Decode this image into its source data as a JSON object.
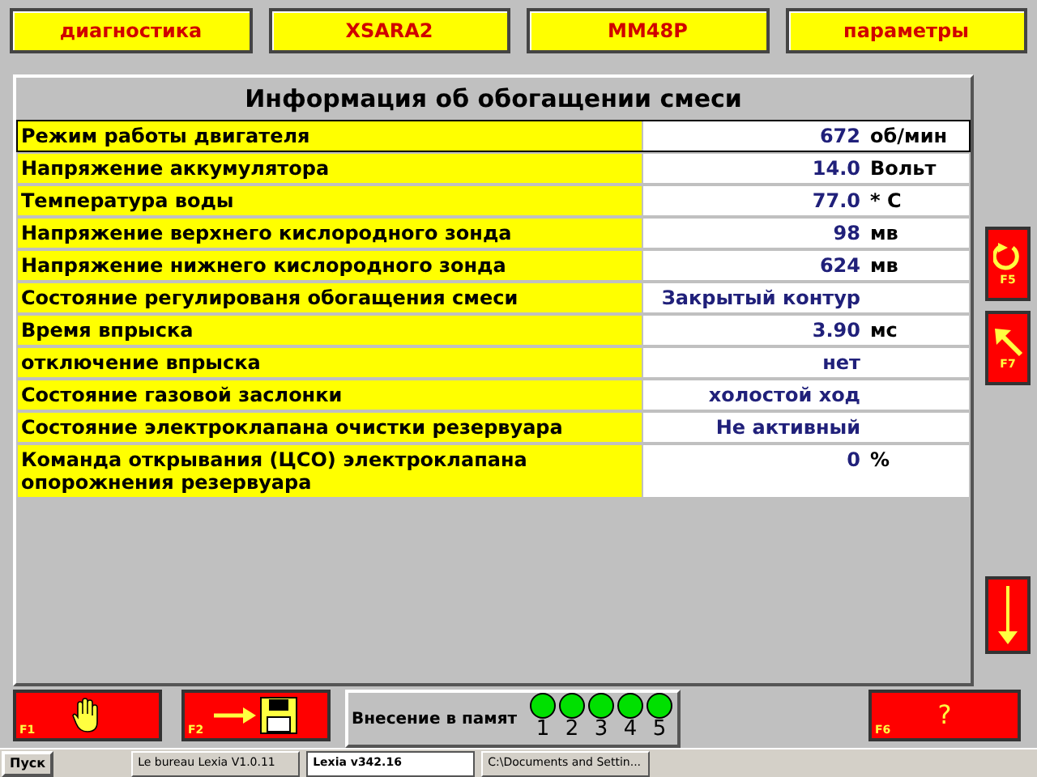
{
  "top_buttons": [
    {
      "label": "диагностика"
    },
    {
      "label": "XSARA2"
    },
    {
      "label": "MM48P"
    },
    {
      "label": "параметры"
    }
  ],
  "panel": {
    "title": "Информация об обогащении смеси",
    "rows": [
      {
        "label": "Режим работы двигателя",
        "value": "672",
        "unit": "об/мин",
        "selected": true
      },
      {
        "label": "Напряжение аккумулятора",
        "value": "14.0",
        "unit": "Вольт",
        "selected": false
      },
      {
        "label": "Температура воды",
        "value": "77.0",
        "unit": "* C",
        "selected": false
      },
      {
        "label": "Напряжение верхнего кислородного зонда",
        "value": "98",
        "unit": "мв",
        "selected": false
      },
      {
        "label": "Напряжение нижнего кислородного зонда",
        "value": "624",
        "unit": "мв",
        "selected": false
      },
      {
        "label": "Состояние регулированя обогащения смеси",
        "value": "Закрытый контур",
        "selected": false
      },
      {
        "label": "Время впрыска",
        "value": "3.90",
        "unit": "мс",
        "selected": false
      },
      {
        "label": "отключение впрыска",
        "value": "нет",
        "selected": false
      },
      {
        "label": "Состояние газовой заслонки",
        "value": "холостой ход",
        "selected": false
      },
      {
        "label": "Состояние электроклапана очистки резервуара",
        "value": "Не активный",
        "selected": false
      },
      {
        "label": "Команда открывания (ЦСО) электроклапана опорожнения резервуара",
        "value": "0",
        "unit": "%",
        "selected": false
      }
    ]
  },
  "side_buttons": [
    {
      "kind": "refresh",
      "key": "F5"
    },
    {
      "kind": "back",
      "key": "F7"
    },
    {
      "kind": "down"
    }
  ],
  "bottom": {
    "buttons": [
      {
        "kind": "stop",
        "key": "F1"
      },
      {
        "kind": "save",
        "key": "F2"
      }
    ],
    "memory": {
      "label": "Внесение в памят",
      "slots": [
        "1",
        "2",
        "3",
        "4",
        "5"
      ]
    },
    "help": {
      "key": "F6",
      "label": "?"
    }
  },
  "taskbar": {
    "start": "Пуск",
    "tasks": [
      {
        "label": "Le bureau Lexia V1.0.11",
        "selected": false
      },
      {
        "label": "Lexia v342.16",
        "selected": true
      },
      {
        "label": "C:\\Documents and Settin...",
        "selected": false
      }
    ]
  }
}
